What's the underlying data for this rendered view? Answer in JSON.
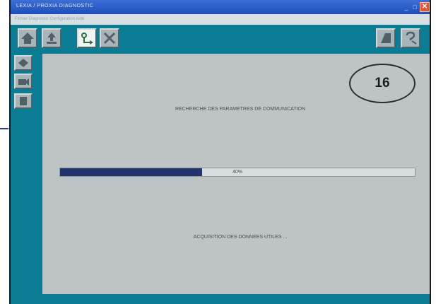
{
  "window": {
    "title": "LEXIA / PROXIA DIAGNOSTIC",
    "controls": {
      "minimize": "_",
      "maximize": "□",
      "close": "✕"
    }
  },
  "menubar": {
    "text": "Fichier   Diagnostic   Configuration   Aide"
  },
  "toolbar": {
    "icons": [
      "home-icon",
      "upload-icon",
      "connection-icon",
      "tools-icon",
      "printer-icon",
      "help-icon"
    ]
  },
  "sidebar": {
    "icons": [
      "tag-icon",
      "camera-icon",
      "document-icon"
    ]
  },
  "main": {
    "badge": "16",
    "status_title": "RECHERCHE DES PARAMETRES DE COMMUNICATION",
    "progress": {
      "value": 40,
      "label": "40%"
    },
    "status_sub": "ACQUISITION DES DONNEES UTILES ..."
  },
  "colors": {
    "window_bg": "#0a7d94",
    "panel_bg": "#bdc4c6",
    "progress_fill": "#22346e",
    "titlebar": "#1e4fb8"
  }
}
